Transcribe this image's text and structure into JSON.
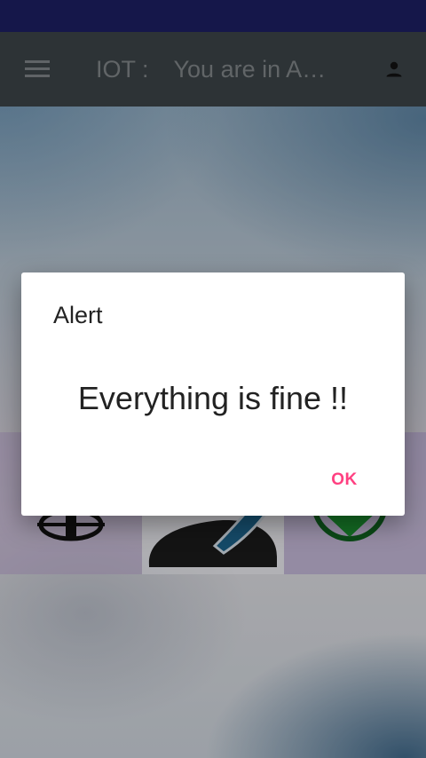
{
  "app_bar": {
    "title_prefix": "IOT :",
    "title_text": "You are in A…",
    "menu_icon": "hamburger-menu-icon",
    "profile_icon": "person-icon"
  },
  "tiles": [
    {
      "icon": "settings-gear-icon"
    },
    {
      "icon": "phone-handset-icon"
    },
    {
      "icon": "check-circle-icon"
    }
  ],
  "dialog": {
    "title": "Alert",
    "message": "Everything is fine !!",
    "ok_label": "OK"
  },
  "colors": {
    "status_bar": "#15174a",
    "app_bar": "#3a4246",
    "accent": "#ff4081"
  }
}
